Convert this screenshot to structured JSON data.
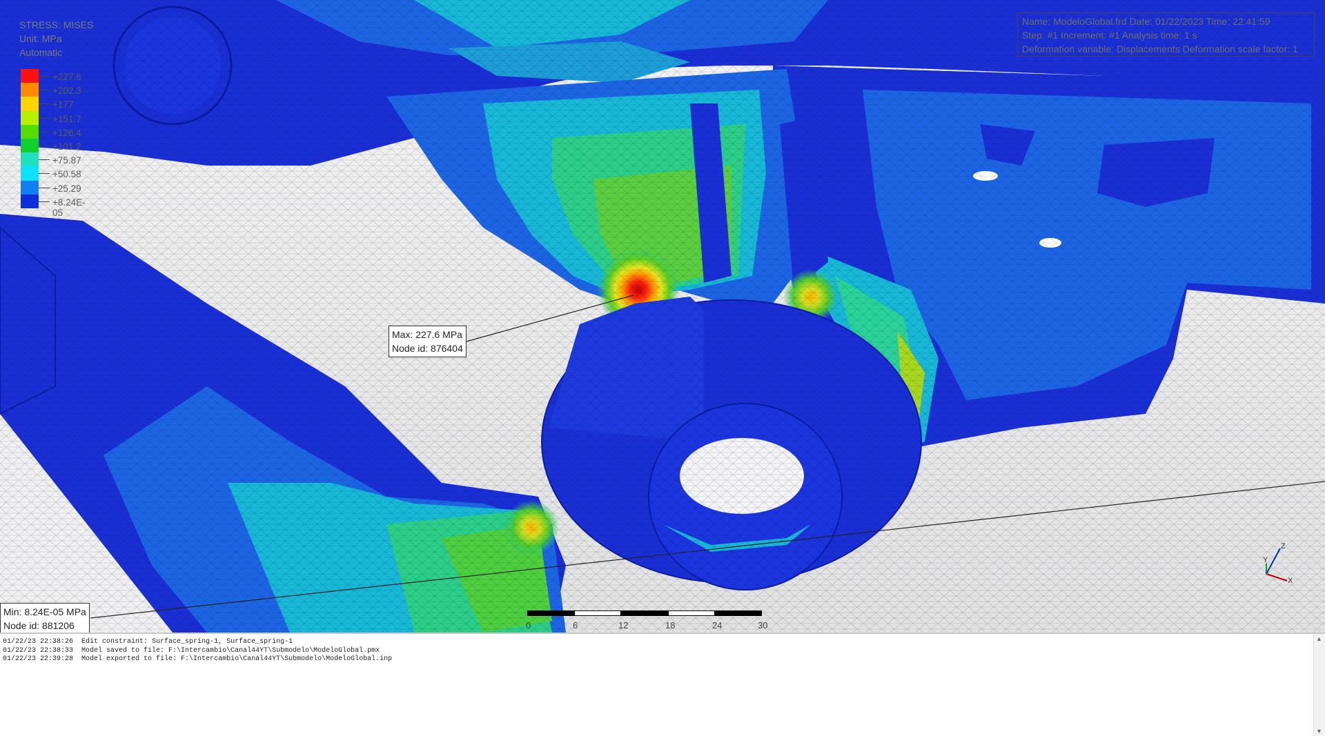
{
  "legend": {
    "variable": "STRESS: MISES",
    "unit": "Unit: MPa",
    "mode": "Automatic",
    "levels": [
      {
        "label": "+227.6",
        "color": "#ff1010"
      },
      {
        "label": "+202.3",
        "color": "#ff8a00"
      },
      {
        "label": "+177",
        "color": "#ffd400"
      },
      {
        "label": "+151.7",
        "color": "#b8f000"
      },
      {
        "label": "+126.4",
        "color": "#55dd00"
      },
      {
        "label": "+101.2",
        "color": "#10d030"
      },
      {
        "label": "+75.87",
        "color": "#20e0c0"
      },
      {
        "label": "+50.58",
        "color": "#10e0ff"
      },
      {
        "label": "+25.29",
        "color": "#1080f0"
      },
      {
        "label": "+8.24E-05",
        "color": "#0a2ed8"
      }
    ]
  },
  "info": {
    "line1": "Name: ModeloGlobal.frd   Date: 01/22/2023   Time: 22:41:59",
    "line2": "Step: #1   Increment: #1   Analysis time: 1 s",
    "line3": "Deformation variable: Displacements   Deformation scale factor: 1"
  },
  "max_callout": {
    "line1": "Max: 227.6 MPa",
    "line2": "Node id: 876404"
  },
  "min_callout": {
    "line1": "Min: 8.24E-05 MPa",
    "line2": "Node id: 881206"
  },
  "scale_bar": {
    "labels": [
      "0",
      "6",
      "12",
      "18",
      "24",
      "30 mm"
    ]
  },
  "triad": {
    "x": "X",
    "y": "Y",
    "z": "Z"
  },
  "console": {
    "lines": [
      {
        "time": "01/22/23 22:38:26",
        "msg": "Edit constraint: Surface_spring-1, Surface_spring-1"
      },
      {
        "time": "01/22/23 22:38:33",
        "msg": "Model saved to file: F:\\Intercambio\\Canal44YT\\Submodelo\\ModeloGlobal.pmx"
      },
      {
        "time": "01/22/23 22:39:28",
        "msg": "Model exported to file: F:\\Intercambio\\Canal44YT\\Submodelo\\ModeloGlobal.inp"
      }
    ]
  },
  "colors": {
    "blue_low": "#1a2fd6",
    "blue_mid": "#1c66e6",
    "cyan": "#18b8d8",
    "green": "#3ccf3a",
    "yellow": "#d8e020",
    "red": "#e02010"
  }
}
